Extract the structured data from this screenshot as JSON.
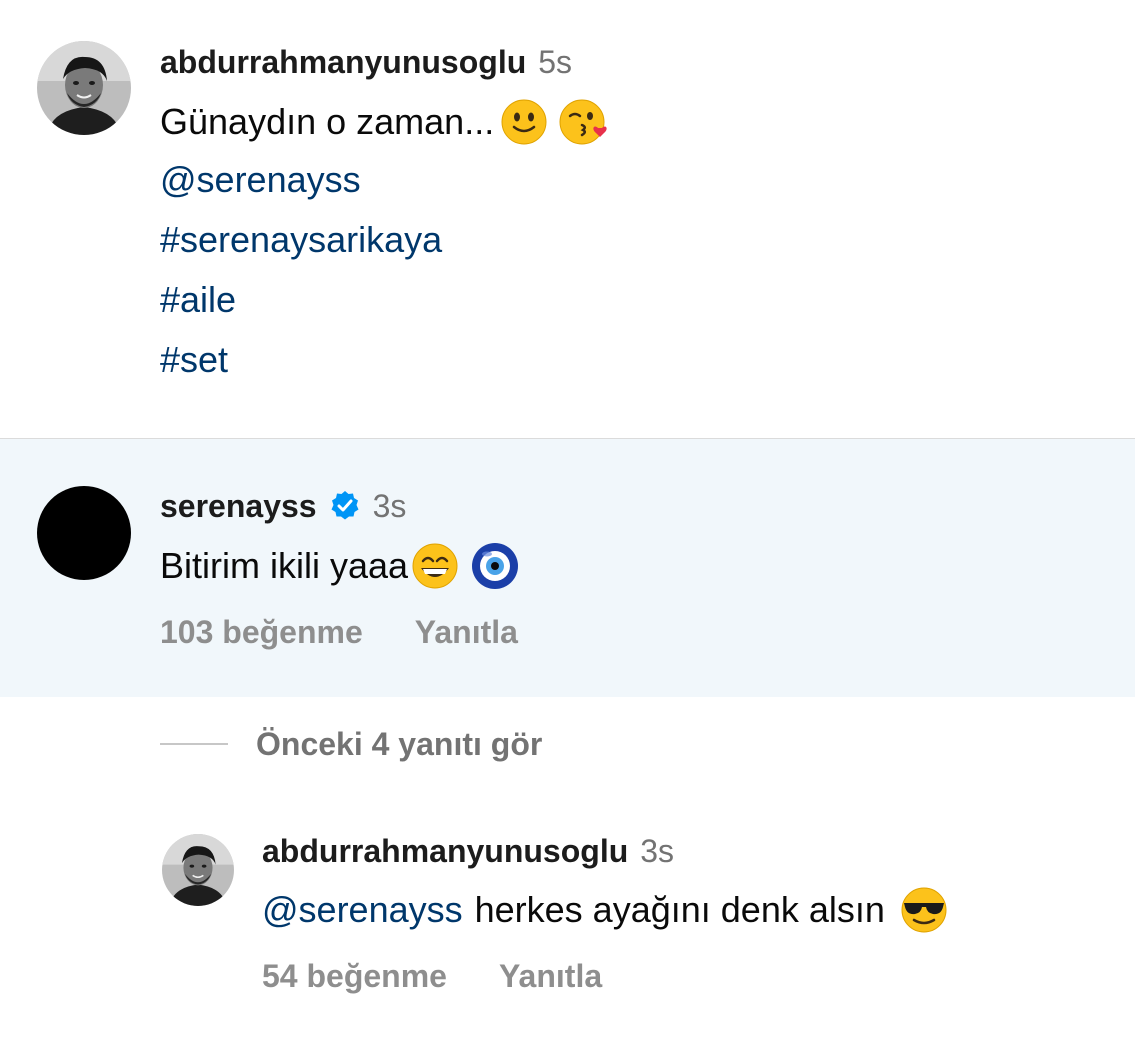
{
  "caption": {
    "username": "abdurrahmanyunusoglu",
    "time": "5s",
    "text": "Günaydın o zaman...",
    "emojis": [
      "slightly-smiling-face-emoji",
      "face-blowing-kiss-emoji"
    ],
    "mention": "@serenayss",
    "hashtags": [
      "#serenaysarikaya",
      "#aile",
      "#set"
    ]
  },
  "comment": {
    "username": "serenayss",
    "verified_icon": "verified-badge-icon",
    "time": "3s",
    "text": "Bitirim ikili yaaa",
    "emojis": [
      "grinning-face-emoji",
      "nazar-amulet-emoji"
    ],
    "likes_label": "103 beğenme",
    "reply_label": "Yanıtla"
  },
  "view_replies": {
    "label": "Önceki 4 yanıtı gör"
  },
  "reply": {
    "username": "abdurrahmanyunusoglu",
    "time": "3s",
    "mention": "@serenayss",
    "text": "herkes ayağını denk alsın",
    "emojis": [
      "smiling-face-with-sunglasses-emoji"
    ],
    "likes_label": "54 beğenme",
    "reply_label": "Yanıtla"
  },
  "colors": {
    "link": "#00376b",
    "meta": "#8e8e8e",
    "highlight_bg": "#f1f7fb",
    "verified": "#0095f6"
  }
}
